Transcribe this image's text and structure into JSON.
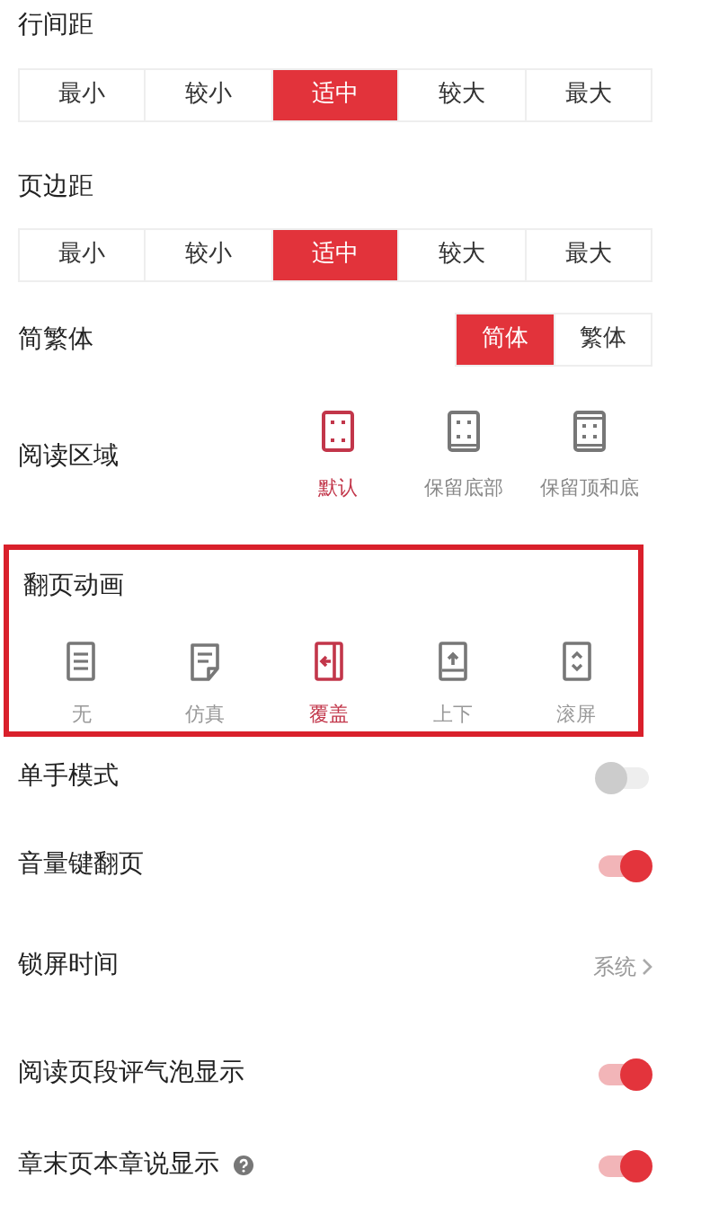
{
  "line_spacing": {
    "title": "行间距",
    "options": [
      {
        "label": "最小",
        "selected": false
      },
      {
        "label": "较小",
        "selected": false
      },
      {
        "label": "适中",
        "selected": true
      },
      {
        "label": "较大",
        "selected": false
      },
      {
        "label": "最大",
        "selected": false
      }
    ]
  },
  "page_margin": {
    "title": "页边距",
    "options": [
      {
        "label": "最小",
        "selected": false
      },
      {
        "label": "较小",
        "selected": false
      },
      {
        "label": "适中",
        "selected": true
      },
      {
        "label": "较大",
        "selected": false
      },
      {
        "label": "最大",
        "selected": false
      }
    ]
  },
  "script": {
    "title": "简繁体",
    "options": [
      {
        "label": "简体",
        "selected": true
      },
      {
        "label": "繁体",
        "selected": false
      }
    ]
  },
  "reading_area": {
    "title": "阅读区域",
    "options": [
      {
        "label": "默认",
        "selected": true
      },
      {
        "label": "保留底部",
        "selected": false
      },
      {
        "label": "保留顶和底",
        "selected": false
      }
    ]
  },
  "page_animation": {
    "title": "翻页动画",
    "highlighted": true,
    "options": [
      {
        "label": "无",
        "selected": false
      },
      {
        "label": "仿真",
        "selected": false
      },
      {
        "label": "覆盖",
        "selected": true
      },
      {
        "label": "上下",
        "selected": false
      },
      {
        "label": "滚屏",
        "selected": false
      }
    ]
  },
  "settings": [
    {
      "kind": "toggle",
      "label": "单手模式",
      "on": false
    },
    {
      "kind": "toggle",
      "label": "音量键翻页",
      "on": true
    },
    {
      "kind": "link",
      "label": "锁屏时间",
      "value": "系统"
    },
    {
      "kind": "toggle",
      "label": "阅读页段评气泡显示",
      "on": true
    },
    {
      "kind": "toggle",
      "label": "章末页本章说显示",
      "on": true,
      "help": true
    }
  ]
}
